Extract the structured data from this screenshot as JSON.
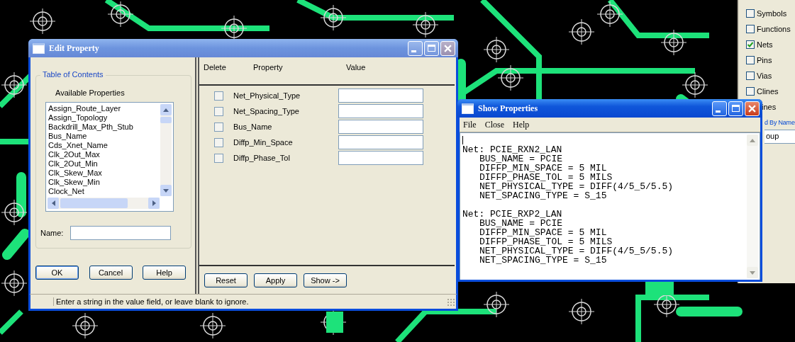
{
  "edit_property": {
    "title": "Edit Property",
    "table_of_contents": {
      "legend": "Table of Contents",
      "list_label": "Available Properties",
      "available_properties": [
        "Assign_Route_Layer",
        "Assign_Topology",
        "Backdrill_Max_Pth_Stub",
        "Bus_Name",
        "Cds_Xnet_Name",
        "Clk_2Out_Max",
        "Clk_2Out_Min",
        "Clk_Skew_Max",
        "Clk_Skew_Min",
        "Clock_Net"
      ],
      "name_label": "Name:"
    },
    "buttons": [
      "OK",
      "Cancel",
      "Help"
    ],
    "columns": [
      "Delete",
      "Property",
      "Value"
    ],
    "properties": [
      {
        "name": "Net_Physical_Type",
        "delete": false
      },
      {
        "name": "Net_Spacing_Type",
        "delete": false
      },
      {
        "name": "Bus_Name",
        "delete": false
      },
      {
        "name": "Diffp_Min_Space",
        "delete": false
      },
      {
        "name": "Diffp_Phase_Tol",
        "delete": false
      }
    ],
    "action_buttons": [
      "Reset",
      "Apply",
      "Show ->"
    ],
    "status": "Enter a string in the value field, or leave blank to ignore."
  },
  "show_properties": {
    "title": "Show Properties",
    "menu": [
      "File",
      "Close",
      "Help"
    ],
    "nets": [
      {
        "net": "Net: PCIE_RXN2_LAN",
        "lines": [
          "BUS_NAME = PCIE",
          "DIFFP_MIN_SPACE = 5 MIL",
          "DIFFP_PHASE_TOL = 5 MILS",
          "NET_PHYSICAL_TYPE = DIFF(4/5_5/5.5)",
          "NET_SPACING_TYPE = S_15"
        ]
      },
      {
        "net": "Net: PCIE_RXP2_LAN",
        "lines": [
          "BUS_NAME = PCIE",
          "DIFFP_MIN_SPACE = 5 MIL",
          "DIFFP_PHASE_TOL = 5 MILS",
          "NET_PHYSICAL_TYPE = DIFF(4/5_5/5.5)",
          "NET_SPACING_TYPE = S_15"
        ]
      }
    ]
  },
  "find_panel": {
    "options": [
      {
        "label": "Symbols",
        "checked": false
      },
      {
        "label": "Functions",
        "checked": false
      },
      {
        "label": "Nets",
        "checked": true
      },
      {
        "label": "Pins",
        "checked": false
      },
      {
        "label": "Vias",
        "checked": false
      },
      {
        "label": "Clines",
        "checked": false
      }
    ],
    "cut_label": "ines",
    "section": "d By Name",
    "field_value": "oup"
  }
}
